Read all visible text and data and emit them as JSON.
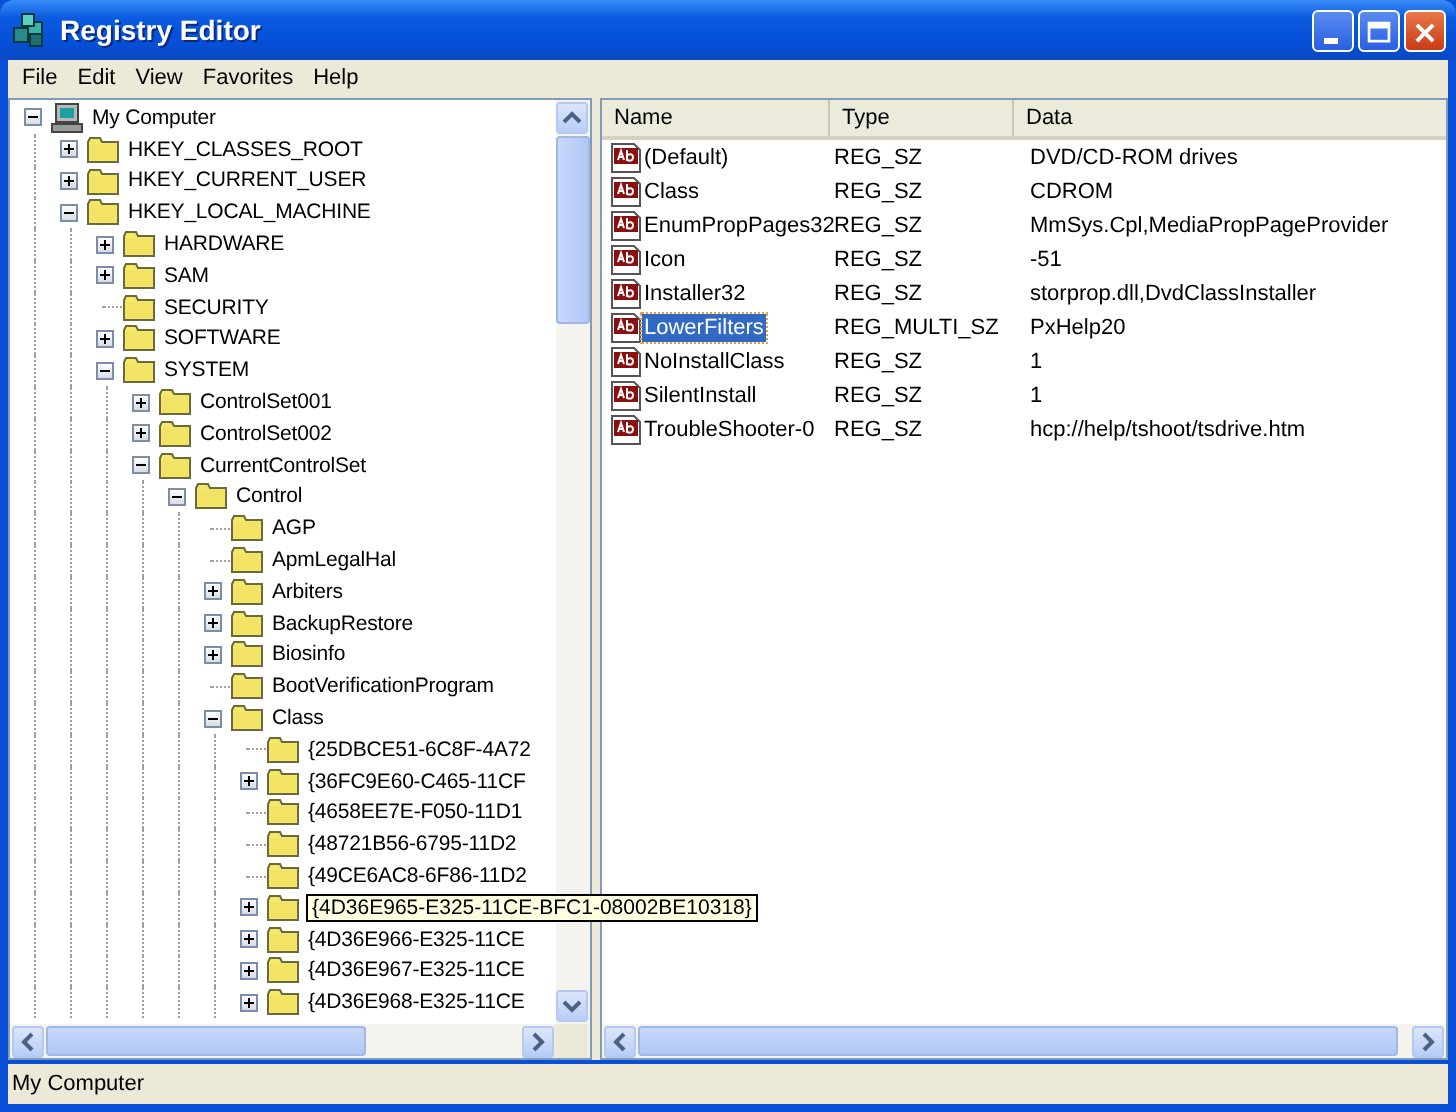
{
  "window": {
    "title": "Registry Editor"
  },
  "menu": [
    "File",
    "Edit",
    "View",
    "Favorites",
    "Help"
  ],
  "tree": {
    "label": "My Computer",
    "kind": "computer",
    "expanded": true,
    "children": [
      {
        "label": "HKEY_CLASSES_ROOT",
        "expanded": false
      },
      {
        "label": "HKEY_CURRENT_USER",
        "expanded": false
      },
      {
        "label": "HKEY_LOCAL_MACHINE",
        "expanded": true,
        "children": [
          {
            "label": "HARDWARE",
            "expanded": false
          },
          {
            "label": "SAM",
            "expanded": false
          },
          {
            "label": "SECURITY"
          },
          {
            "label": "SOFTWARE",
            "expanded": false
          },
          {
            "label": "SYSTEM",
            "expanded": true,
            "children": [
              {
                "label": "ControlSet001",
                "expanded": false
              },
              {
                "label": "ControlSet002",
                "expanded": false
              },
              {
                "label": "CurrentControlSet",
                "expanded": true,
                "children": [
                  {
                    "label": "Control",
                    "expanded": true,
                    "children": [
                      {
                        "label": "AGP"
                      },
                      {
                        "label": "ApmLegalHal"
                      },
                      {
                        "label": "Arbiters",
                        "expanded": false
                      },
                      {
                        "label": "BackupRestore",
                        "expanded": false
                      },
                      {
                        "label": "Biosinfo",
                        "expanded": false
                      },
                      {
                        "label": "BootVerificationProgram"
                      },
                      {
                        "label": "Class",
                        "expanded": true,
                        "children": [
                          {
                            "label": "{25DBCE51-6C8F-4A72"
                          },
                          {
                            "label": "{36FC9E60-C465-11CF",
                            "expanded": false
                          },
                          {
                            "label": "{4658EE7E-F050-11D1"
                          },
                          {
                            "label": "{48721B56-6795-11D2"
                          },
                          {
                            "label": "{49CE6AC8-6F86-11D2"
                          },
                          {
                            "tooltip": "{4D36E965-E325-11CE-BFC1-08002BE10318}",
                            "expanded": false
                          },
                          {
                            "label": "{4D36E966-E325-11CE",
                            "expanded": false
                          },
                          {
                            "label": "{4D36E967-E325-11CE",
                            "expanded": false
                          },
                          {
                            "label": "{4D36E968-E325-11CE",
                            "expanded": false
                          }
                        ]
                      }
                    ]
                  }
                ]
              }
            ]
          }
        ]
      }
    ]
  },
  "list": {
    "columns": [
      "Name",
      "Type",
      "Data"
    ],
    "rows": [
      {
        "name": "(Default)",
        "type": "REG_SZ",
        "data": "DVD/CD-ROM drives",
        "selected": false
      },
      {
        "name": "Class",
        "type": "REG_SZ",
        "data": "CDROM",
        "selected": false
      },
      {
        "name": "EnumPropPages32",
        "type": "REG_SZ",
        "data": "MmSys.Cpl,MediaPropPageProvider",
        "selected": false
      },
      {
        "name": "Icon",
        "type": "REG_SZ",
        "data": "-51",
        "selected": false
      },
      {
        "name": "Installer32",
        "type": "REG_SZ",
        "data": "storprop.dll,DvdClassInstaller",
        "selected": false
      },
      {
        "name": "LowerFilters",
        "type": "REG_MULTI_SZ",
        "data": "PxHelp20",
        "selected": true
      },
      {
        "name": "NoInstallClass",
        "type": "REG_SZ",
        "data": "1",
        "selected": false
      },
      {
        "name": "SilentInstall",
        "type": "REG_SZ",
        "data": "1",
        "selected": false
      },
      {
        "name": "TroubleShooter-0",
        "type": "REG_SZ",
        "data": "hcp://help/tshoot/tsdrive.htm",
        "selected": false
      }
    ]
  },
  "status_bar": "My Computer"
}
